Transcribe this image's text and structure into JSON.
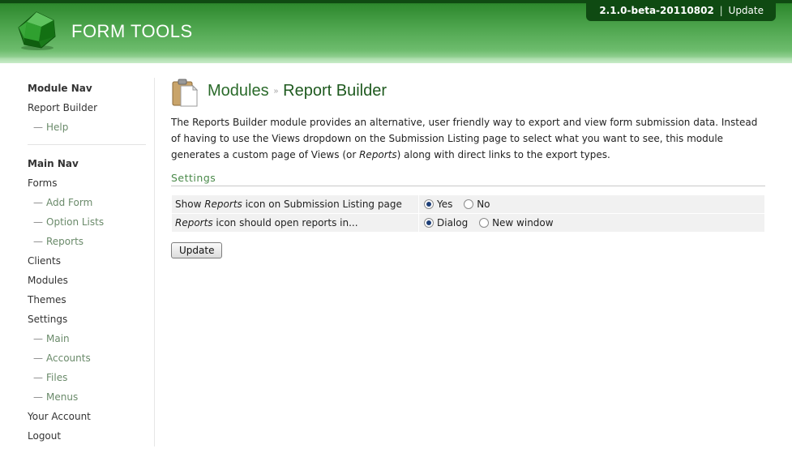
{
  "header": {
    "app_title": "FORM TOOLS",
    "version": "2.1.0-beta-20110802",
    "separator": "|",
    "update_link": "Update"
  },
  "sidebar": {
    "module_nav_heading": "Module Nav",
    "module_items": [
      {
        "label": "Report Builder"
      },
      {
        "label": "Help",
        "sub": true
      }
    ],
    "main_nav_heading": "Main Nav",
    "main_items": [
      {
        "label": "Forms"
      },
      {
        "label": "Add Form",
        "sub": true
      },
      {
        "label": "Option Lists",
        "sub": true
      },
      {
        "label": "Reports",
        "sub": true
      },
      {
        "label": "Clients"
      },
      {
        "label": "Modules"
      },
      {
        "label": "Themes"
      },
      {
        "label": "Settings"
      },
      {
        "label": "Main",
        "sub": true
      },
      {
        "label": "Accounts",
        "sub": true
      },
      {
        "label": "Files",
        "sub": true
      },
      {
        "label": "Menus",
        "sub": true
      },
      {
        "label": "Your Account"
      },
      {
        "label": "Logout"
      }
    ],
    "sub_dash": "—"
  },
  "main": {
    "breadcrumb_parent": "Modules",
    "breadcrumb_sep": "»",
    "breadcrumb_current": "Report Builder",
    "description_part1": "The Reports Builder module provides an alternative, user friendly way to export and view form submission data. Instead of having to use the Views dropdown on the Submission Listing page to select what you want to see, this module generates a custom page of Views (or ",
    "description_italic": "Reports",
    "description_part2": ") along with direct links to the export types.",
    "settings_heading": "Settings",
    "rows": [
      {
        "label_pre": "Show ",
        "label_italic": "Reports",
        "label_post": " icon on Submission Listing page",
        "options": [
          {
            "label": "Yes",
            "checked": true
          },
          {
            "label": "No",
            "checked": false
          }
        ]
      },
      {
        "label_pre": "",
        "label_italic": "Reports",
        "label_post": " icon should open reports in...",
        "options": [
          {
            "label": "Dialog",
            "checked": true
          },
          {
            "label": "New window",
            "checked": false
          }
        ]
      }
    ],
    "update_button": "Update"
  },
  "icons": {
    "logo": "form-tools-logo-icon",
    "page": "clipboard-icon"
  },
  "colors": {
    "header_green": "#4fa64f",
    "title_green": "#2a6a2a",
    "dark_green": "#0f4a12"
  }
}
